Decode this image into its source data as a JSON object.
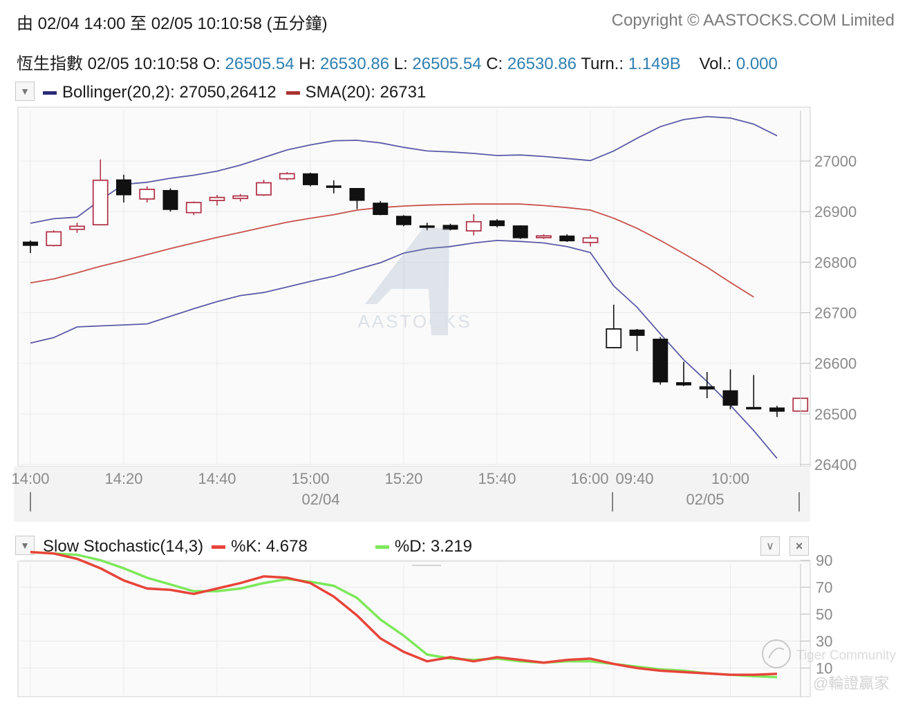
{
  "header": {
    "range_label": "由  02/04 14:00 至  02/05 10:10:58 (五分鐘)",
    "copyright": "Copyright © AASTOCKS.COM Limited",
    "quote_name": "恆生指數 ",
    "quote_time": "02/05 10:10:58",
    "o_label": " O: ",
    "o_value": "26505.54",
    "h_label": " H: ",
    "h_value": "26530.86",
    "l_label": " L: ",
    "l_value": "26505.54",
    "c_label": " C: ",
    "c_value": "26530.86",
    "turn_label": " Turn.: ",
    "turn_value": "1.149B",
    "vol_label": "    Vol.: ",
    "vol_value": "0.000"
  },
  "main_legend": {
    "bollinger": "Bollinger(20,2): 27050,26412",
    "sma": "SMA(20): 26731"
  },
  "stoch_legend": {
    "title": "Slow Stochastic(14,3)",
    "k": "%K: 4.678",
    "d": "%D: 3.219"
  },
  "watermarks": {
    "brand": "AASTOCKS",
    "community": "Tiger Community",
    "handle": "@輪證贏家"
  },
  "colors": {
    "bollinger": "#5b5aa8",
    "sma": "#c8504a",
    "candle_up": "#b2344a",
    "candle_down": "#111111",
    "k_line": "#e8443a",
    "d_line": "#7de85a",
    "value_text": "#2f7fb0"
  },
  "chart_data": [
    {
      "type": "candlestick",
      "title": "恆生指數",
      "ylim": [
        26400,
        27000
      ],
      "yticks": [
        27000,
        26900,
        26800,
        26700,
        26600,
        26500,
        26400
      ],
      "xticks": [
        {
          "i": 0,
          "label": "14:00"
        },
        {
          "i": 4,
          "label": "14:20"
        },
        {
          "i": 8,
          "label": "14:40"
        },
        {
          "i": 12,
          "label": "15:00"
        },
        {
          "i": 16,
          "label": "15:20"
        },
        {
          "i": 20,
          "label": "15:40"
        },
        {
          "i": 24,
          "label": "16:00"
        },
        {
          "i": 25,
          "label": "09:40"
        },
        {
          "i": 30,
          "label": "10:00"
        }
      ],
      "date_labels": [
        {
          "i": 12.5,
          "label": "02/04"
        },
        {
          "i": 29,
          "label": "02/05"
        }
      ],
      "session_breaks": [
        -0.05,
        24.98,
        33.35
      ],
      "candles": [
        {
          "o": 26840,
          "c": 26833,
          "h": 26843,
          "l": 26818
        },
        {
          "o": 26833,
          "c": 26860,
          "h": 26863,
          "l": 26831
        },
        {
          "o": 26865,
          "c": 26871,
          "h": 26878,
          "l": 26858
        },
        {
          "o": 26874,
          "c": 26962,
          "h": 27003,
          "l": 26873
        },
        {
          "o": 26963,
          "c": 26933,
          "h": 26973,
          "l": 26918
        },
        {
          "o": 26925,
          "c": 26944,
          "h": 26950,
          "l": 26918
        },
        {
          "o": 26942,
          "c": 26904,
          "h": 26946,
          "l": 26900
        },
        {
          "o": 26898,
          "c": 26918,
          "h": 26920,
          "l": 26893
        },
        {
          "o": 26922,
          "c": 26928,
          "h": 26933,
          "l": 26912
        },
        {
          "o": 26926,
          "c": 26931,
          "h": 26935,
          "l": 26920
        },
        {
          "o": 26933,
          "c": 26957,
          "h": 26963,
          "l": 26931
        },
        {
          "o": 26965,
          "c": 26975,
          "h": 26978,
          "l": 26962
        },
        {
          "o": 26975,
          "c": 26953,
          "h": 26977,
          "l": 26950
        },
        {
          "o": 26951,
          "c": 26950,
          "h": 26962,
          "l": 26936
        },
        {
          "o": 26946,
          "c": 26922,
          "h": 26946,
          "l": 26905
        },
        {
          "o": 26917,
          "c": 26894,
          "h": 26921,
          "l": 26893
        },
        {
          "o": 26891,
          "c": 26874,
          "h": 26893,
          "l": 26871
        },
        {
          "o": 26872,
          "c": 26871,
          "h": 26878,
          "l": 26863
        },
        {
          "o": 26873,
          "c": 26865,
          "h": 26876,
          "l": 26863
        },
        {
          "o": 26862,
          "c": 26880,
          "h": 26895,
          "l": 26853
        },
        {
          "o": 26882,
          "c": 26872,
          "h": 26885,
          "l": 26869
        },
        {
          "o": 26872,
          "c": 26848,
          "h": 26873,
          "l": 26846
        },
        {
          "o": 26849,
          "c": 26852,
          "h": 26855,
          "l": 26846
        },
        {
          "o": 26852,
          "c": 26842,
          "h": 26855,
          "l": 26840
        },
        {
          "o": 26839,
          "c": 26848,
          "h": 26854,
          "l": 26831
        },
        {
          "o": 26631,
          "c": 26668,
          "h": 26716,
          "l": 26630
        },
        {
          "o": 26666,
          "c": 26655,
          "h": 26668,
          "l": 26624
        },
        {
          "o": 26648,
          "c": 26563,
          "h": 26652,
          "l": 26558
        },
        {
          "o": 26562,
          "c": 26557,
          "h": 26603,
          "l": 26555
        },
        {
          "o": 26554,
          "c": 26549,
          "h": 26583,
          "l": 26531
        },
        {
          "o": 26546,
          "c": 26517,
          "h": 26588,
          "l": 26509
        },
        {
          "o": 26513,
          "c": 26511,
          "h": 26577,
          "l": 26510
        },
        {
          "o": 26512,
          "c": 26505,
          "h": 26516,
          "l": 26494
        },
        {
          "o": 26505.54,
          "c": 26530.86,
          "h": 26530.86,
          "l": 26505.54
        }
      ],
      "bollinger_upper": [
        26877,
        26886,
        26889,
        26923,
        26954,
        26958,
        26966,
        26972,
        26980,
        26992,
        27007,
        27022,
        27032,
        27040,
        27041,
        27036,
        27027,
        27020,
        27018,
        27015,
        27011,
        27012,
        27009,
        27005,
        27001,
        27020,
        27045,
        27068,
        27082,
        27088,
        27085,
        27073,
        27050
      ],
      "bollinger_lower": [
        26640,
        26651,
        26672,
        26674,
        26676,
        26678,
        26693,
        26708,
        26722,
        26734,
        26740,
        26751,
        26762,
        26772,
        26786,
        26799,
        26818,
        26827,
        26831,
        26838,
        26843,
        26841,
        26838,
        26831,
        26819,
        26753,
        26711,
        26658,
        26607,
        26564,
        26517,
        26467,
        26412
      ],
      "sma": [
        26759,
        26767,
        26779,
        26792,
        26803,
        26815,
        26827,
        26838,
        26849,
        26859,
        26869,
        26879,
        26887,
        26894,
        26903,
        26908,
        26911,
        26913,
        26914,
        26915,
        26915,
        26915,
        26912,
        26908,
        26903,
        26887,
        26867,
        26843,
        26817,
        26790,
        26760,
        26731
      ]
    },
    {
      "type": "line",
      "title": "Slow Stochastic(14,3)",
      "ylim": [
        0,
        100
      ],
      "yticks": [
        90,
        70,
        50,
        30,
        10
      ],
      "series": [
        {
          "name": "%K",
          "values": [
            96,
            95,
            91,
            84,
            75,
            69,
            68,
            65,
            69,
            73,
            78,
            77,
            73,
            63,
            49,
            32,
            22,
            15,
            18,
            15,
            18,
            16,
            14,
            16,
            17,
            13,
            10,
            8,
            7,
            6,
            5,
            5,
            5.678
          ]
        },
        {
          "name": "%D",
          "values": [
            96,
            95,
            94,
            90,
            84,
            77,
            72,
            67,
            67,
            69,
            73,
            76,
            74,
            71,
            62,
            46,
            34,
            20,
            17,
            16,
            17,
            15,
            14,
            15,
            15,
            13,
            11,
            9,
            8,
            6,
            5,
            4,
            3.219
          ]
        }
      ]
    }
  ]
}
